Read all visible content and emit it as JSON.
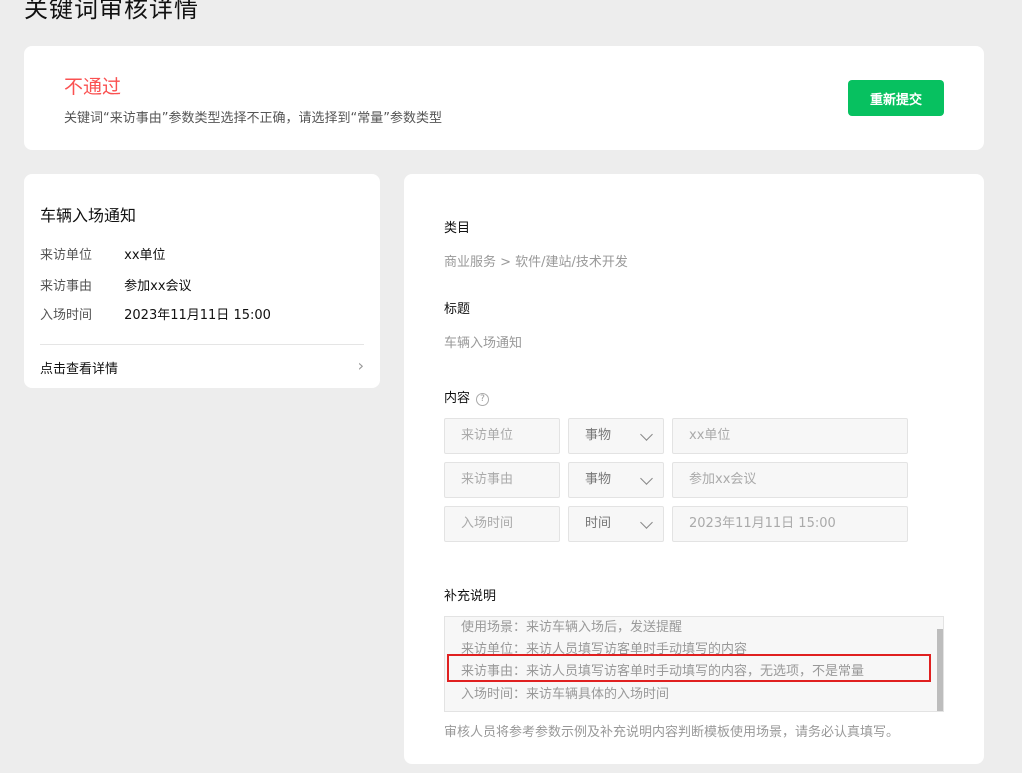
{
  "page_title": "关键词审核详情",
  "status": {
    "title": "不通过",
    "reason": "关键词“来访事由”参数类型选择不正确，请选择到“常量”参数类型",
    "resubmit_label": "重新提交",
    "colors": {
      "reject": "#fa5151",
      "primary": "#07c160"
    }
  },
  "preview": {
    "title": "车辆入场通知",
    "rows": [
      {
        "label": "来访单位",
        "value": "xx单位"
      },
      {
        "label": "来访事由",
        "value": "参加xx会议"
      },
      {
        "label": "入场时间",
        "value": "2023年11月11日 15:00"
      }
    ],
    "link_label": "点击查看详情"
  },
  "detail": {
    "category_label": "类目",
    "category_value": "商业服务 > 软件/建站/技术开发",
    "title_label": "标题",
    "title_value": "车辆入场通知",
    "content_label": "内容",
    "help_icon": "question-circle-icon",
    "params": [
      {
        "name": "来访单位",
        "type": "事物",
        "example": "xx单位"
      },
      {
        "name": "来访事由",
        "type": "事物",
        "example": "参加xx会议"
      },
      {
        "name": "入场时间",
        "type": "时间",
        "example": "2023年11月11日 15:00"
      }
    ],
    "note_label": "补充说明",
    "note_lines": [
      "使用场景：来访车辆入场后，发送提醒",
      "来访单位：来访人员填写访客单时手动填写的内容",
      "来访事由：来访人员填写访客单时手动填写的内容，无选项，不是常量",
      "入场时间：来访车辆具体的入场时间"
    ],
    "footer_note": "审核人员将参考参数示例及补充说明内容判断模板使用场景，请务必认真填写。"
  }
}
